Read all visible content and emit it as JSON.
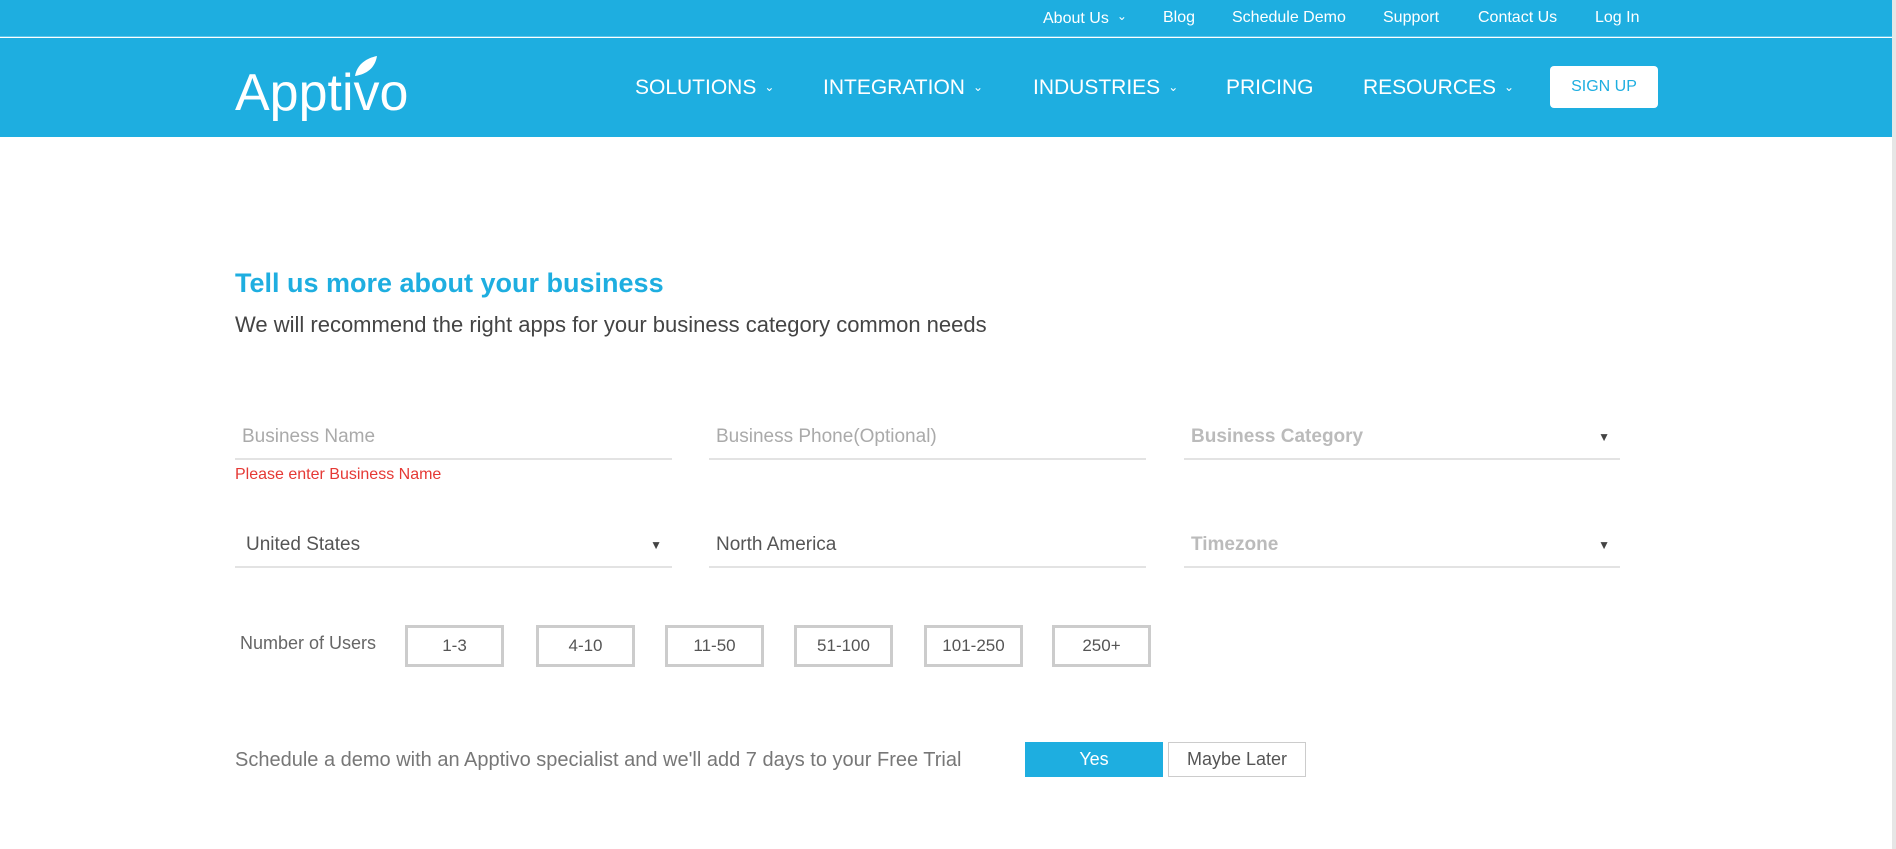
{
  "top_links": [
    "About Us",
    "Blog",
    "Schedule Demo",
    "Support",
    "Contact Us",
    "Log In"
  ],
  "logo": "Apptivo",
  "nav": {
    "items": [
      "SOLUTIONS",
      "INTEGRATION",
      "INDUSTRIES",
      "PRICING",
      "RESOURCES"
    ],
    "signup": "SIGN UP"
  },
  "form": {
    "title": "Tell us more about your business",
    "subtitle": "We will recommend the right apps for your business category common needs",
    "business_name_placeholder": "Business Name",
    "business_name_error": "Please enter Business Name",
    "phone_placeholder": "Business Phone(Optional)",
    "category_placeholder": "Business Category",
    "country": "United States",
    "region": "North America",
    "timezone_placeholder": "Timezone",
    "users_label": "Number of Users",
    "user_options": [
      "1-3",
      "4-10",
      "11-50",
      "51-100",
      "101-250",
      "250+"
    ],
    "demo_text": "Schedule a demo with an Apptivo specialist and we'll add 7 days to your Free Trial",
    "yes": "Yes",
    "maybe_later": "Maybe Later"
  },
  "colors": {
    "brand": "#1eaee0",
    "error": "#e53935"
  }
}
